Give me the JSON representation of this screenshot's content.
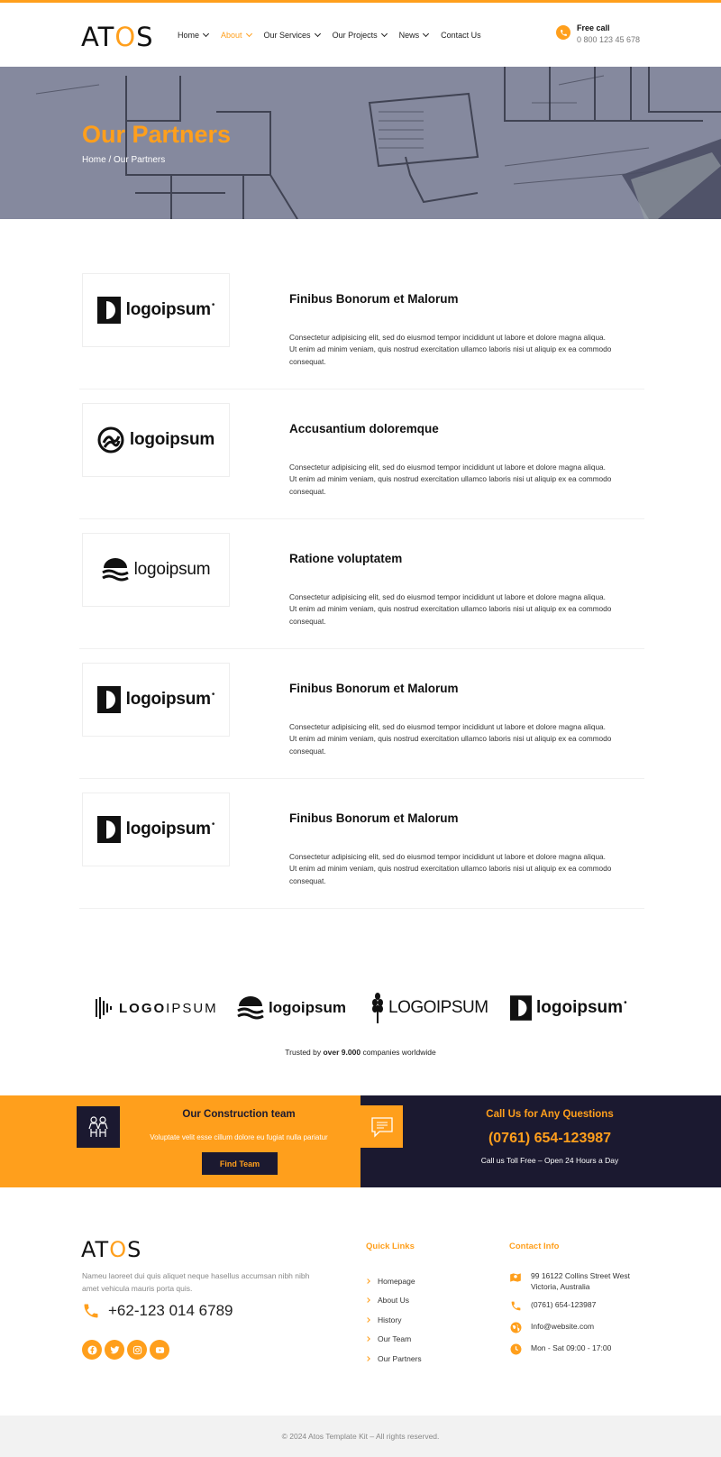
{
  "header": {
    "logo_prefix": "AT",
    "logo_o": "O",
    "logo_suffix": "S",
    "nav": [
      {
        "label": "Home",
        "has_dropdown": true
      },
      {
        "label": "About",
        "has_dropdown": true,
        "active": true
      },
      {
        "label": "Our Services",
        "has_dropdown": true
      },
      {
        "label": "Our Projects",
        "has_dropdown": true
      },
      {
        "label": "News",
        "has_dropdown": true
      },
      {
        "label": "Contact Us",
        "has_dropdown": false
      }
    ],
    "free_call_title": "Free call",
    "free_call_number": "0 800 123 45 678"
  },
  "hero": {
    "title": "Our Partners",
    "breadcrumb": "Home / Our Partners"
  },
  "partners": [
    {
      "logo_text": "logoipsum",
      "logo_icon": "half-circle-logo-icon",
      "name": "Finibus Bonorum et Malorum",
      "description": "Consectetur adipisicing elit, sed do eiusmod tempor incididunt ut labore et dolore magna aliqua. Ut enim ad minim veniam, quis nostrud exercitation ullamco laboris nisi ut aliquip ex ea commodo consequat."
    },
    {
      "logo_text": "logoipsum",
      "logo_icon": "swirl-circle-logo-icon",
      "name": "Accusantium doloremque",
      "description": "Consectetur adipisicing elit, sed do eiusmod tempor incididunt ut labore et dolore magna aliqua. Ut enim ad minim veniam, quis nostrud exercitation ullamco laboris nisi ut aliquip ex ea commodo consequat."
    },
    {
      "logo_text": "logoipsum",
      "logo_icon": "wave-sun-logo-icon",
      "name": "Ratione voluptatem",
      "description": "Consectetur adipisicing elit, sed do eiusmod tempor incididunt ut labore et dolore magna aliqua. Ut enim ad minim veniam, quis nostrud exercitation ullamco laboris nisi ut aliquip ex ea commodo consequat."
    },
    {
      "logo_text": "logoipsum",
      "logo_icon": "half-circle-logo-icon",
      "name": "Finibus Bonorum et Malorum",
      "description": "Consectetur adipisicing elit, sed do eiusmod tempor incididunt ut labore et dolore magna aliqua. Ut enim ad minim veniam, quis nostrud exercitation ullamco laboris nisi ut aliquip ex ea commodo consequat."
    },
    {
      "logo_text": "logoipsum",
      "logo_icon": "half-circle-logo-icon",
      "name": "Finibus Bonorum et Malorum",
      "description": "Consectetur adipisicing elit, sed do eiusmod tempor incididunt ut labore et dolore magna aliqua. Ut enim ad minim veniam, quis nostrud exercitation ullamco laboris nisi ut aliquip ex ea commodo consequat."
    }
  ],
  "brands": [
    {
      "text_a": "LOGO",
      "text_b": "IPSUM",
      "icon": "bars-logo-icon"
    },
    {
      "text_a": "logoipsum",
      "icon": "wave-sun-logo-icon"
    },
    {
      "text_a": "LOGOIPSUM",
      "icon": "wheat-logo-icon"
    },
    {
      "text_a": "logoipsum",
      "icon": "half-circle-logo-icon"
    }
  ],
  "trusted": {
    "prefix": "Trusted by ",
    "bold": "over 9.000",
    "suffix": " companies worldwide"
  },
  "cta": {
    "team_title": "Our Construction team",
    "team_text": "Voluptate velit esse cillum dolore eu fugiat nulla pariatur",
    "team_button": "Find Team",
    "call_title": "Call Us for Any Questions",
    "call_phone": "(0761) 654-123987",
    "call_sub": "Call us Toll Free – Open 24 Hours a Day"
  },
  "footer": {
    "logo_prefix": "AT",
    "logo_o": "O",
    "logo_suffix": "S",
    "description": "Nameu laoreet dui quis aliquet neque hasellus accumsan nibh nibh amet vehicula mauris porta quis.",
    "phone": "+62-123 014 6789",
    "socials": [
      "facebook-icon",
      "twitter-icon",
      "instagram-icon",
      "youtube-icon"
    ],
    "quick_links_title": "Quick Links",
    "quick_links": [
      "Homepage",
      "About Us",
      "History",
      "Our Team",
      "Our Partners"
    ],
    "contact_title": "Contact Info",
    "contact_address": "99 16122 Collins Street West Victoria, Australia",
    "contact_phone": "(0761) 654-123987",
    "contact_email": "Info@website.com",
    "contact_hours": "Mon - Sat 09:00 - 17:00",
    "copyright": "© 2024 Atos Template Kit – All rights reserved."
  },
  "colors": {
    "accent": "#ff9f1c",
    "dark": "#1b1930"
  }
}
